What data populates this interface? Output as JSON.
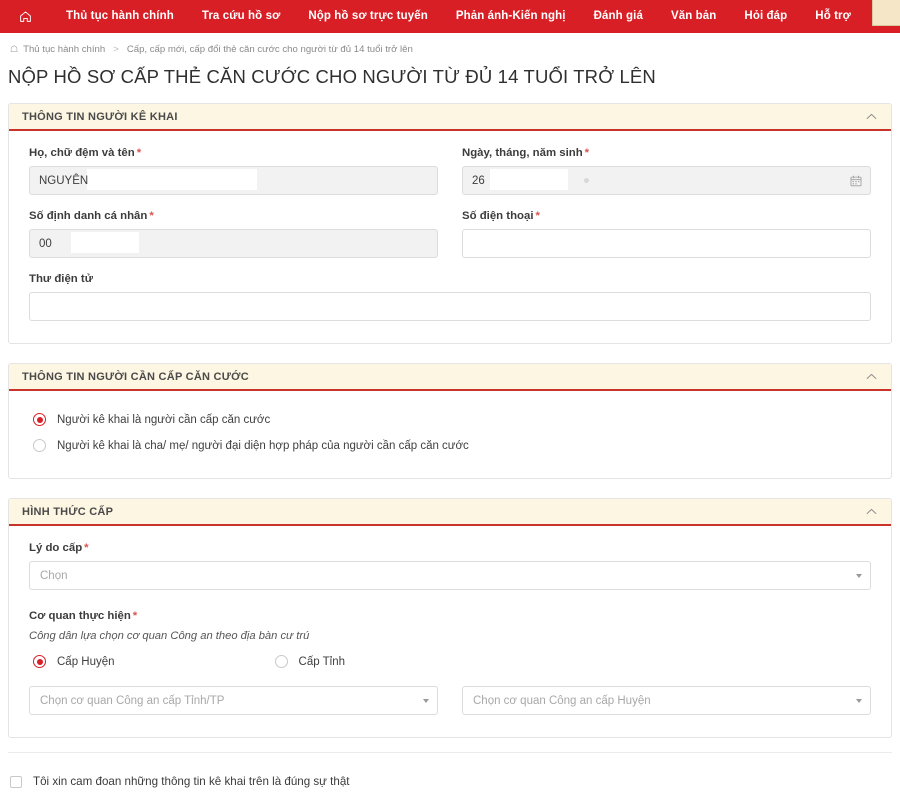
{
  "nav": {
    "home_icon": "home-icon",
    "items": [
      {
        "label": "Thủ tục hành chính"
      },
      {
        "label": "Tra cứu hồ sơ"
      },
      {
        "label": "Nộp hồ sơ trực tuyến"
      },
      {
        "label": "Phản ánh-Kiến nghị"
      },
      {
        "label": "Đánh giá"
      },
      {
        "label": "Văn bản"
      },
      {
        "label": "Hỏi đáp"
      },
      {
        "label": "Hỗ trợ"
      }
    ],
    "bg_color": "#d81f26"
  },
  "breadcrumb": {
    "home_icon": "home-outline-icon",
    "root": "Thủ tục hành chính",
    "separator": ">",
    "current": "Cấp, cấp mới, cấp đổi thẻ căn cước cho người từ đủ 14 tuổi trở lên"
  },
  "page": {
    "title": "NỘP HỒ SƠ CẤP THẺ CĂN CƯỚC CHO NGƯỜI TỪ ĐỦ 14 TUỔI TRỞ LÊN",
    "accent_color": "#c8332c",
    "header_bg": "#fdf6e3"
  },
  "section_declarant": {
    "title": "THÔNG TIN NGƯỜI KÊ KHAI",
    "collapse_icon": "chevron-up-icon",
    "fields": {
      "full_name": {
        "label": "Họ, chữ đệm và tên",
        "required_mark": "*",
        "value": "NGUYÊN",
        "placeholder": ""
      },
      "dob": {
        "label": "Ngày, tháng, năm sinh",
        "required_mark": "*",
        "value": "26",
        "placeholder": "",
        "icon": "calendar-icon"
      },
      "personal_id": {
        "label": "Số định danh cá nhân",
        "required_mark": "*",
        "value": "00",
        "placeholder": ""
      },
      "phone": {
        "label": "Số điện thoại",
        "required_mark": "*",
        "value": "",
        "placeholder": ""
      },
      "email": {
        "label": "Thư điện tử",
        "required_mark": "",
        "value": "",
        "placeholder": ""
      }
    }
  },
  "section_subject": {
    "title": "THÔNG TIN NGƯỜI CẦN CẤP CĂN CƯỚC",
    "collapse_icon": "chevron-up-icon",
    "options": [
      {
        "label": "Người kê khai là người cần cấp căn cước",
        "selected": true
      },
      {
        "label": "Người kê khai là cha/ mẹ/ người đại diện hợp pháp của người cần cấp căn cước",
        "selected": false
      }
    ]
  },
  "section_issue": {
    "title": "HÌNH THỨC CẤP",
    "collapse_icon": "chevron-up-icon",
    "reason": {
      "label": "Lý do cấp",
      "required_mark": "*",
      "placeholder": "Chọn",
      "value": ""
    },
    "agency": {
      "label": "Cơ quan thực hiện",
      "required_mark": "*",
      "hint": "Công dân lựa chọn cơ quan Công an theo địa bàn cư trú",
      "levels": [
        {
          "label": "Cấp Huyện",
          "selected": true
        },
        {
          "label": "Cấp Tỉnh",
          "selected": false
        }
      ],
      "province_select": {
        "placeholder": "Chọn cơ quan Công an cấp Tỉnh/TP",
        "value": ""
      },
      "district_select": {
        "placeholder": "Chọn cơ quan Công an cấp Huyện",
        "value": ""
      }
    }
  },
  "consent": {
    "label": "Tôi xin cam đoan những thông tin kê khai trên là đúng sự thật",
    "checked": false
  }
}
